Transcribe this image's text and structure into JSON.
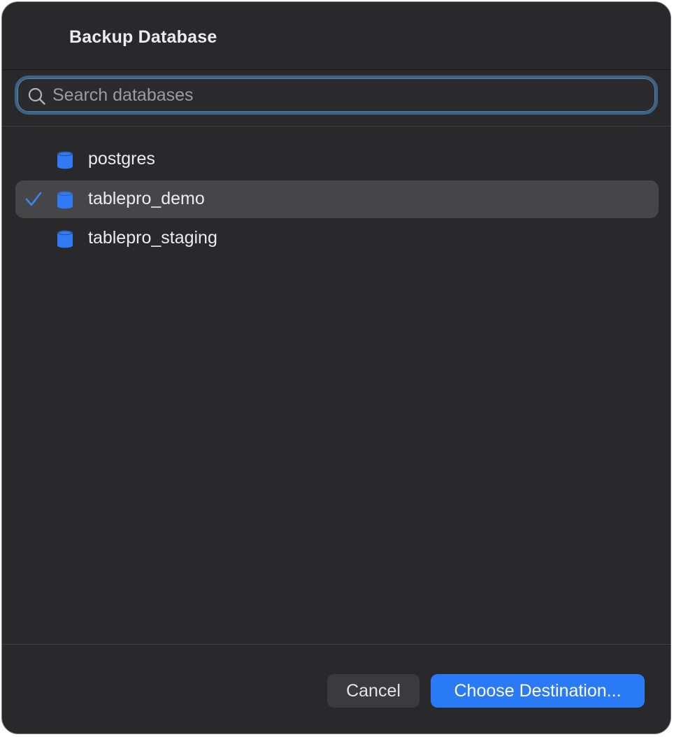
{
  "dialog": {
    "title": "Backup Database"
  },
  "search": {
    "placeholder": "Search databases",
    "value": ""
  },
  "databases": [
    {
      "name": "postgres",
      "selected": false
    },
    {
      "name": "tablepro_demo",
      "selected": true
    },
    {
      "name": "tablepro_staging",
      "selected": false
    }
  ],
  "buttons": {
    "cancel_label": "Cancel",
    "primary_label": "Choose Destination..."
  },
  "colors": {
    "background": "#29282a",
    "accent": "#2a7af6",
    "selected_row": "#464547",
    "db_icon": "#2f7bf5",
    "checkmark": "#3d84f7"
  },
  "icons": {
    "search": "search-icon",
    "database": "database-icon",
    "check": "checkmark-icon"
  }
}
